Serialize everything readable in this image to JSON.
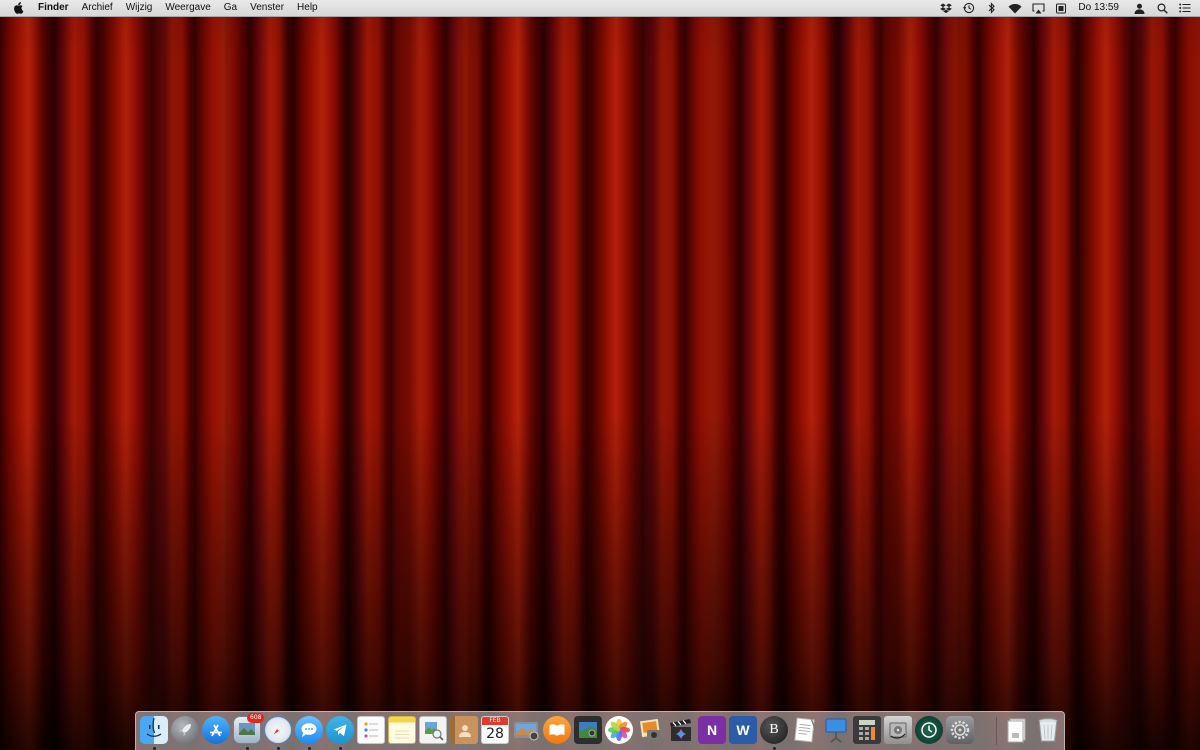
{
  "menubar": {
    "apple_icon": "apple-icon",
    "app_name": "Finder",
    "menus": [
      "Archief",
      "Wijzig",
      "Weergave",
      "Ga",
      "Venster",
      "Help"
    ],
    "status_icons": [
      "dropbox-icon",
      "time-machine-icon",
      "bluetooth-icon",
      "wifi-icon",
      "airplay-icon",
      "battery-icon",
      "user-icon",
      "spotlight-icon",
      "notification-center-icon"
    ],
    "clock": "Do 13:59"
  },
  "desktop": {
    "wallpaper": "red-theatre-curtain",
    "accent_color": "#8a0c02"
  },
  "dock": {
    "apps": [
      {
        "name": "finder",
        "running": true
      },
      {
        "name": "launchpad",
        "running": false
      },
      {
        "name": "app-store",
        "running": false
      },
      {
        "name": "mail",
        "running": true,
        "badge": "608"
      },
      {
        "name": "safari",
        "running": true
      },
      {
        "name": "messages",
        "running": true
      },
      {
        "name": "telegram",
        "running": true
      },
      {
        "name": "reminders",
        "running": false
      },
      {
        "name": "notes",
        "running": false
      },
      {
        "name": "preview",
        "running": false
      },
      {
        "name": "contacts",
        "running": false
      },
      {
        "name": "calendar",
        "running": false,
        "month": "FEB",
        "day": "28"
      },
      {
        "name": "image-capture",
        "running": false
      },
      {
        "name": "ibooks",
        "running": false
      },
      {
        "name": "photo-booth",
        "running": false
      },
      {
        "name": "photos",
        "running": false
      },
      {
        "name": "iphoto",
        "running": false
      },
      {
        "name": "final-cut-pro",
        "running": false
      },
      {
        "name": "onenote",
        "running": false,
        "letter": "N"
      },
      {
        "name": "word",
        "running": false,
        "letter": "W"
      },
      {
        "name": "bbedit",
        "running": true,
        "letter": "B"
      },
      {
        "name": "textedit",
        "running": false
      },
      {
        "name": "keynote",
        "running": false
      },
      {
        "name": "calculator",
        "running": false
      },
      {
        "name": "disk-utility",
        "running": false
      },
      {
        "name": "time-machine",
        "running": false
      },
      {
        "name": "system-preferences",
        "running": false
      }
    ],
    "others": [
      {
        "name": "documents-stack"
      },
      {
        "name": "trash"
      }
    ]
  }
}
